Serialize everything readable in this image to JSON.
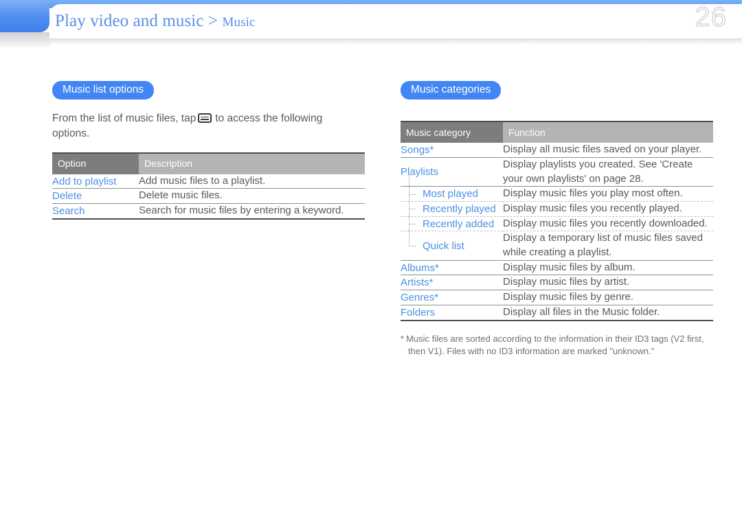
{
  "header": {
    "breadcrumb_main": "Play video and music >",
    "breadcrumb_sub": "Music",
    "page_number": "26",
    "accent_blue": "#4285f4",
    "title_blue": "#5b8ee8"
  },
  "left_column": {
    "section_badge": "Music list options",
    "intro_before_icon": "From the list of music files, tap",
    "intro_icon": "menu-icon",
    "intro_after_icon": "to access the following options.",
    "table": {
      "headers": [
        "Option",
        "Description"
      ],
      "rows": [
        {
          "option": "Add to playlist",
          "description": "Add music files to a playlist."
        },
        {
          "option": "Delete",
          "description": "Delete music files."
        },
        {
          "option": "Search",
          "description": "Search for music files by entering a keyword."
        }
      ]
    }
  },
  "right_column": {
    "section_badge": "Music categories",
    "table": {
      "headers": [
        "Music category",
        "Function"
      ],
      "rows": [
        {
          "category": "Songs*",
          "function": "Display all music files saved on your player.",
          "level": 0
        },
        {
          "category": "Playlists",
          "function": "Display playlists you created. See 'Create your own playlists' on page 28.",
          "level": 0
        },
        {
          "category": "Most played",
          "function": "Display music files you play most often.",
          "level": 1
        },
        {
          "category": "Recently played",
          "function": "Display music files you recently played.",
          "level": 1
        },
        {
          "category": "Recently added",
          "function": "Display music files you recently downloaded.",
          "level": 1
        },
        {
          "category": "Quick list",
          "function": "Display a temporary list of music files saved while creating a playlist.",
          "level": 1
        },
        {
          "category": "Albums*",
          "function": "Display music files by album.",
          "level": 0
        },
        {
          "category": "Artists*",
          "function": "Display music files by artist.",
          "level": 0
        },
        {
          "category": "Genres*",
          "function": "Display music files by genre.",
          "level": 0
        },
        {
          "category": "Folders",
          "function": "Display all files in the Music folder.",
          "level": 0
        }
      ]
    },
    "footnote_line1": "Music files are sorted according to the information in their ID3 tags (V2 first,",
    "footnote_line2": "then V1). Files with no ID3 information are marked \"unknown.\"",
    "footnote_marker": "*"
  }
}
